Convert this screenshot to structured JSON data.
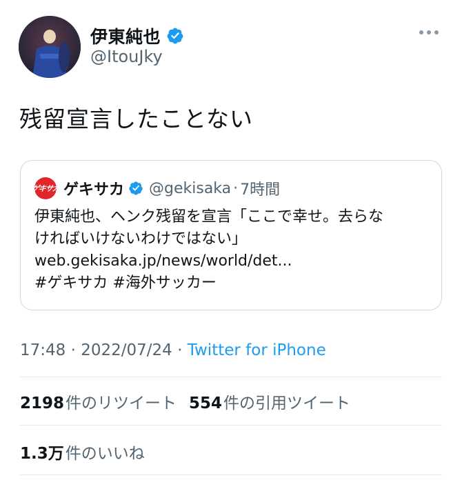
{
  "author": {
    "display_name": "伊東純也",
    "handle": "@ItouJky"
  },
  "tweet": {
    "text": "残留宣言したことない"
  },
  "quoted": {
    "avatar_text": "ゲキサカ",
    "display_name": "ゲキサカ",
    "handle": "@gekisaka",
    "separator": "·",
    "time": "7時間",
    "lines": [
      "伊東純也、ヘンク残留を宣言「ここで幸せ。去らな",
      "ければいけないわけではない」",
      "web.gekisaka.jp/news/world/det...",
      "#ゲキサカ #海外サッカー"
    ]
  },
  "meta": {
    "time": "17:48",
    "sep1": " · ",
    "date": "2022/07/24",
    "sep2": " · ",
    "source": "Twitter for iPhone"
  },
  "stats": {
    "retweets": "2198",
    "retweets_label": "件のリツイート",
    "quotes": "554",
    "quotes_label": "件の引用ツイート",
    "likes": "1.3万",
    "likes_label": "件のいいね"
  },
  "colors": {
    "accent": "#1d9bf0",
    "verified": "#1d9bf0",
    "quote_brand": "#e0262b"
  }
}
